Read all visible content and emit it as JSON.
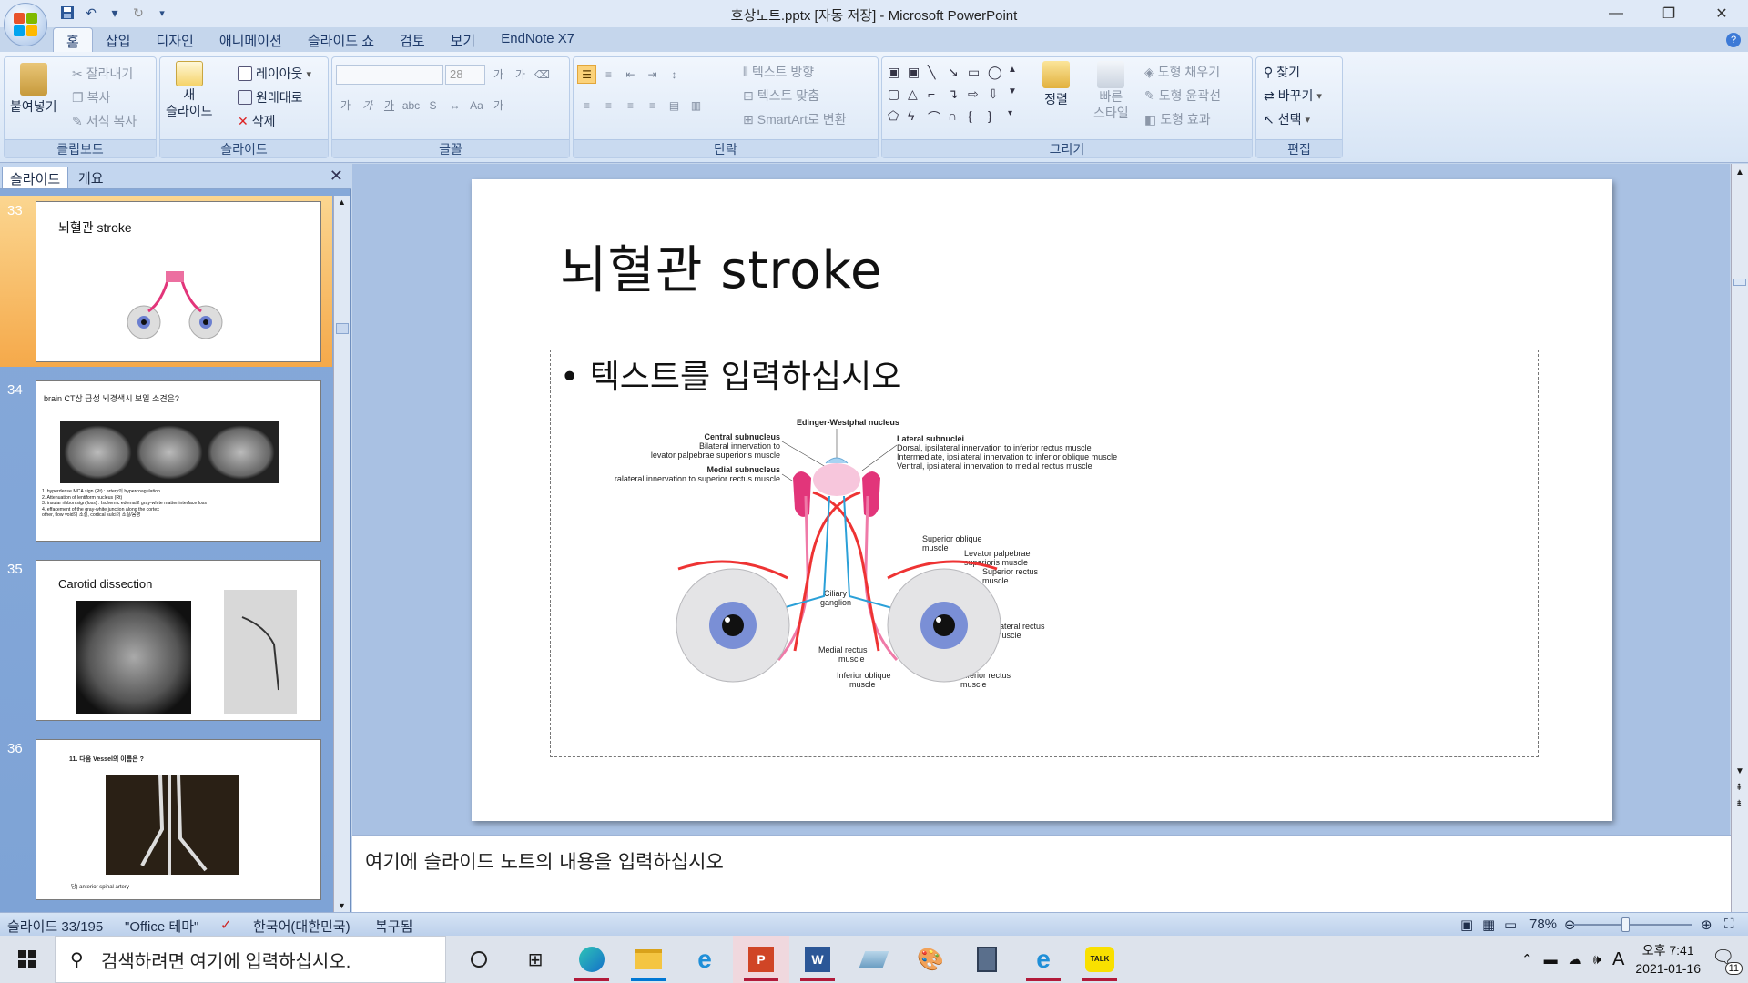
{
  "window": {
    "title": "호상노트.pptx [자동 저장] - Microsoft PowerPoint",
    "controls": {
      "minimize": "—",
      "maximize": "❐",
      "close": "✕"
    }
  },
  "ribbon_tabs": [
    "홈",
    "삽입",
    "디자인",
    "애니메이션",
    "슬라이드 쇼",
    "검토",
    "보기",
    "EndNote X7"
  ],
  "ribbon": {
    "clipboard": {
      "paste": "붙여넣기",
      "cut": "잘라내기",
      "copy": "복사",
      "format_painter": "서식 복사",
      "label": "클립보드"
    },
    "slides": {
      "new_slide": "새",
      "new_slide2": "슬라이드",
      "layout": "레이아웃",
      "reset": "원래대로",
      "delete": "삭제",
      "label": "슬라이드"
    },
    "font": {
      "size": "28",
      "label": "글꼴"
    },
    "paragraph": {
      "text_direction": "텍스트 방향",
      "align_text": "텍스트 맞춤",
      "smartart": "SmartArt로 변환",
      "label": "단락"
    },
    "drawing": {
      "arrange": "정렬",
      "quick_styles": "빠른",
      "quick_styles2": "스타일",
      "shape_fill": "도형 채우기",
      "shape_outline": "도형 윤곽선",
      "shape_effects": "도형 효과",
      "label": "그리기"
    },
    "editing": {
      "find": "찾기",
      "replace": "바꾸기",
      "select": "선택",
      "label": "편집"
    }
  },
  "left_panel": {
    "tabs": [
      "슬라이드",
      "개요"
    ],
    "close": "✕",
    "slides": [
      {
        "num": "33",
        "title": "뇌혈관 stroke",
        "selected": true
      },
      {
        "num": "34",
        "title": "brain CT상 급성 뇌경색시 보일 소견은?",
        "notes": [
          "1. hyperdense MCA sign (Rt) : artery의 hypercoagulation",
          "2. Attenuation of lentiform nucleus (Rt)",
          "3. insular ribbon sign(loss) : Ischemic edema로 gray-white matter interface loss",
          "4. effacement of the gray-white junction along the cortex",
          "other, flow void의 소실, cortical sulci의 소실/음영"
        ]
      },
      {
        "num": "35",
        "title": "Carotid dissection"
      },
      {
        "num": "36",
        "title": "11. 다음 Vessel의 이름은 ?",
        "caption": "답) anterior spinal artery"
      }
    ]
  },
  "slide": {
    "title": "뇌혈관 stroke",
    "bullet": "텍스트를 입력하십시오",
    "figure_labels": {
      "ew": "Edinger-Westphal nucleus",
      "central": "Central subnucleus",
      "central_desc1": "Bilateral innervation to",
      "central_desc2": "levator palpebrae superioris muscle",
      "medial": "Medial subnucleus",
      "medial_desc": "Contralateral innervation to superior rectus muscle",
      "lateral": "Lateral subnuclei",
      "lateral_d1": "Dorsal, ipsilateral innervation to inferior rectus muscle",
      "lateral_d2": "Intermediate, ipsilateral innervation to inferior oblique muscle",
      "lateral_d3": "Ventral, ipsilateral innervation to medial rectus muscle",
      "sup_oblique": "Superior oblique",
      "muscle": "muscle",
      "levator": "Levator palpebrae",
      "levator2": "superioris muscle",
      "sup_rectus": "Superior rectus",
      "ciliary": "Ciliary",
      "ganglion": "ganglion",
      "lat_rectus": "Lateral rectus",
      "med_rectus": "Medial rectus",
      "inf_oblique": "Inferior oblique",
      "inf_rectus": "Inferior rectus"
    }
  },
  "notes": {
    "placeholder": "여기에 슬라이드 노트의 내용을 입력하십시오"
  },
  "status_bar": {
    "slide_counter": "슬라이드 33/195",
    "theme": "\"Office 테마\"",
    "language": "한국어(대한민국)",
    "recovered": "복구됨",
    "zoom": "78%"
  },
  "taskbar": {
    "search_placeholder": "검색하려면 여기에 입력하십시오.",
    "time": "오후 7:41",
    "date": "2021-01-16",
    "ime": "A",
    "notifications": "11"
  },
  "colors": {
    "accent": "#f5a94a",
    "ribbon": "#dbe7f6",
    "slide_bg": "#a9c1e3"
  }
}
